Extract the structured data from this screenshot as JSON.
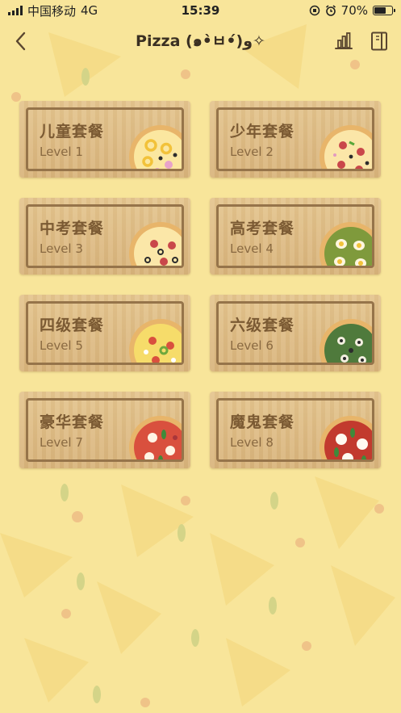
{
  "status": {
    "carrier": "中国移动",
    "network": "4G",
    "time": "15:39",
    "battery": "70%",
    "battery_level": 0.7,
    "icons": [
      "signal-icon",
      "orientation-lock-icon",
      "alarm-icon",
      "battery-icon"
    ]
  },
  "nav": {
    "title": "Pizza (๑•̀ㅂ•́)و✧",
    "back_icon": "chevron-left-icon",
    "stats_icon": "bar-chart-icon",
    "book_icon": "book-icon"
  },
  "colors": {
    "background": "#f8e59a",
    "card_wood": "#dcb882",
    "card_border": "#96744a",
    "title_text": "#7b5a33"
  },
  "levels": [
    {
      "title": "儿童套餐",
      "level": "Level 1",
      "pizza": "cheese-pineapple-pizza"
    },
    {
      "title": "少年套餐",
      "level": "Level 2",
      "pizza": "salami-olive-pizza"
    },
    {
      "title": "中考套餐",
      "level": "Level 3",
      "pizza": "salami-olive-pizza"
    },
    {
      "title": "高考套餐",
      "level": "Level 4",
      "pizza": "egg-pesto-pizza"
    },
    {
      "title": "四级套餐",
      "level": "Level 5",
      "pizza": "tomato-pepper-pizza"
    },
    {
      "title": "六级套餐",
      "level": "Level 6",
      "pizza": "olive-pesto-pizza"
    },
    {
      "title": "豪华套餐",
      "level": "Level 7",
      "pizza": "margherita-pizza"
    },
    {
      "title": "魔鬼套餐",
      "level": "Level 8",
      "pizza": "mozzarella-basil-pizza"
    }
  ]
}
